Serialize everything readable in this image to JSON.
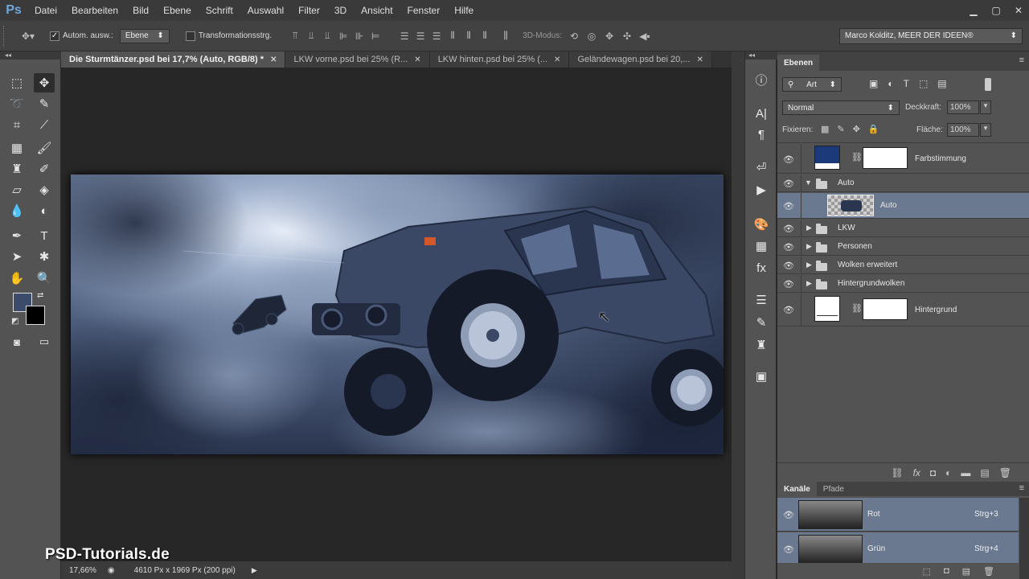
{
  "app": {
    "logo": "Ps"
  },
  "menu": [
    "Datei",
    "Bearbeiten",
    "Bild",
    "Ebene",
    "Schrift",
    "Auswahl",
    "Filter",
    "3D",
    "Ansicht",
    "Fenster",
    "Hilfe"
  ],
  "options": {
    "auto_select_label": "Autom. ausw.:",
    "auto_select_value": "Ebene",
    "transform_label": "Transformationsstrg.",
    "mode_3d_label": "3D-Modus:",
    "workspace": "Marco Kolditz, MEER DER IDEEN®"
  },
  "tabs": [
    {
      "label": "Die Sturmtänzer.psd bei 17,7% (Auto, RGB/8) *",
      "active": true
    },
    {
      "label": "LKW vorne.psd bei 25% (R...",
      "active": false
    },
    {
      "label": "LKW hinten.psd bei 25% (...",
      "active": false
    },
    {
      "label": "Geländewagen.psd bei 20,...",
      "active": false
    }
  ],
  "status": {
    "zoom": "17,66%",
    "doc_size": "4610 Px x 1969 Px (200 ppi)"
  },
  "watermark": "PSD-Tutorials.de",
  "layers_panel": {
    "tab": "Ebenen",
    "filter_kind": "Art",
    "blend_mode": "Normal",
    "opacity_label": "Deckkraft:",
    "opacity_value": "100%",
    "lock_label": "Fixieren:",
    "fill_label": "Fläche:",
    "fill_value": "100%",
    "layers": [
      {
        "name": "Farbstimmung",
        "type": "adjustment"
      },
      {
        "name": "Auto",
        "type": "group",
        "open": true
      },
      {
        "name": "Auto",
        "type": "layer",
        "selected": true
      },
      {
        "name": "LKW",
        "type": "group"
      },
      {
        "name": "Personen",
        "type": "group"
      },
      {
        "name": "Wolken erweitert",
        "type": "group"
      },
      {
        "name": "Hintergrundwolken",
        "type": "group"
      },
      {
        "name": "Hintergrund",
        "type": "adjustment"
      }
    ]
  },
  "channels_panel": {
    "tabs": [
      "Kanäle",
      "Pfade"
    ],
    "channels": [
      {
        "name": "Rot",
        "shortcut": "Strg+3"
      },
      {
        "name": "Grün",
        "shortcut": "Strg+4"
      }
    ]
  },
  "colors": {
    "accent_blue": "#1c3a7a",
    "selection": "#6a7890"
  }
}
